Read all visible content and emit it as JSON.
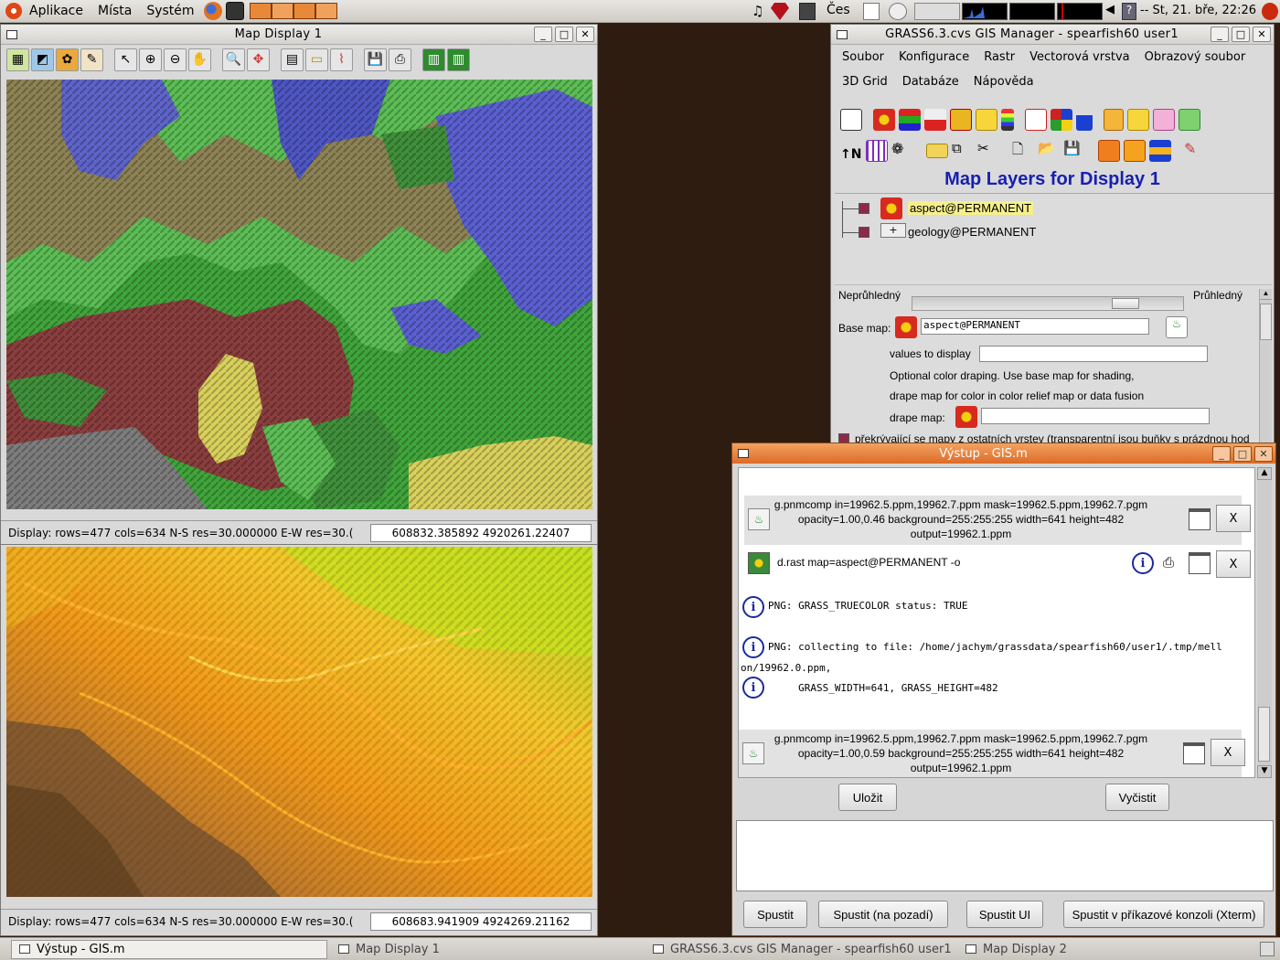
{
  "top_panel": {
    "menus": [
      "Aplikace",
      "Místa",
      "Systém"
    ],
    "keyboard": "Čes",
    "clock": "-- St, 21. bře, 22:26"
  },
  "map_display_1": {
    "title": "Map Display 1",
    "status": "Display: rows=477 cols=634 N-S res=30.000000 E-W res=30.(",
    "coords": "608832.385892 4920261.22407"
  },
  "map_display_2": {
    "status": "Display: rows=477 cols=634 N-S res=30.000000 E-W res=30.(",
    "coords": "608683.941909 4924269.21162"
  },
  "gis_manager": {
    "title": "GRASS6.3.cvs GIS Manager - spearfish60 user1",
    "menus": [
      "Soubor",
      "Konfigurace",
      "Rastr",
      "Vectorová vrstva",
      "Obrazový soubor",
      "3D Grid",
      "Databáze",
      "Nápověda"
    ],
    "heading": "Map Layers for Display 1",
    "layers": [
      {
        "name": "aspect@PERMANENT",
        "selected": true
      },
      {
        "name": "geology@PERMANENT",
        "selected": false
      }
    ],
    "opacity_left": "Neprůhledný",
    "opacity_right": "Průhledný",
    "opacity_value": 0.82,
    "base_map_label": "Base map:",
    "base_map_value": "aspect@PERMANENT",
    "values_label": "values to display",
    "drape_note_1": "Optional color draping. Use base map for shading,",
    "drape_note_2": "drape map for color in color relief map or data fusion",
    "drape_label": "drape map:",
    "cut_text": "překrývající se mapy z ostatních vrstev (transparentní jsou buňky s prázdnou hod"
  },
  "output_window": {
    "title": "Výstup - GIS.m",
    "cmd1": [
      "g.pnmcomp in=19962.5.ppm,19962.7.ppm mask=19962.5.ppm,19962.7.pgm",
      "opacity=1.00,0.46 background=255:255:255 width=641 height=482",
      "output=19962.1.ppm"
    ],
    "cmd2": "d.rast map=aspect@PERMANENT -o",
    "msg1": "PNG: GRASS_TRUECOLOR status: TRUE",
    "msg2a": "PNG: collecting to file: /home/jachym/grassdata/spearfish60/user1/.tmp/mell",
    "msg2b": "on/19962.0.ppm,",
    "msg3": "     GRASS_WIDTH=641, GRASS_HEIGHT=482",
    "cmd3": [
      "g.pnmcomp in=19962.5.ppm,19962.7.ppm mask=19962.5.ppm,19962.7.pgm",
      "opacity=1.00,0.59 background=255:255:255 width=641 height=482",
      "output=19962.1.ppm"
    ],
    "x_label": "X",
    "save_label": "Uložit",
    "clear_label": "Vyčistit",
    "run_label": "Spustit",
    "run_bg_label": "Spustit (na pozadí)",
    "run_ui_label": "Spustit UI",
    "run_xterm_label": "Spustit v příkazové konzoli (Xterm)"
  },
  "taskbar": {
    "items": [
      "Výstup - GIS.m",
      "Map Display 1",
      "GRASS6.3.cvs GIS Manager - spearfish60 user1",
      "Map Display 2"
    ]
  },
  "colors": {
    "gnome_orange": "#dd4814",
    "heading_blue": "#1820b0",
    "output_title": "#dc6b27",
    "desktop": "#2e1c10"
  }
}
